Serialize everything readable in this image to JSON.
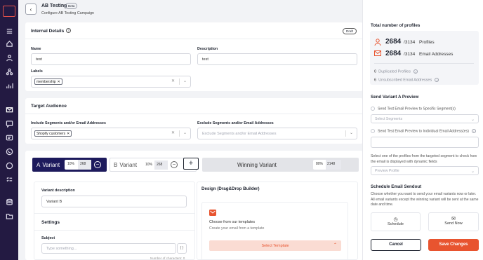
{
  "header": {
    "title": "AB Testing",
    "badge": "Beta",
    "subtitle": "Configure AB Testing Campaign",
    "back_icon": "arrow-left-icon"
  },
  "internal": {
    "title": "Internal Details",
    "status": "Draft",
    "name_label": "Name",
    "name_value": "test",
    "desc_label": "Description",
    "desc_value": "test",
    "labels_label": "Labels",
    "label_chip": "membership"
  },
  "audience": {
    "title": "Target Audience",
    "include_label": "Include Segments and/or Email Addresses",
    "include_chip": "Shopify customers",
    "exclude_label": "Exclude Segments and/or Email Addresses",
    "exclude_placeholder": "Exclude Segments and/or Email Addresses"
  },
  "variants": {
    "a_label": "A",
    "a_text": "Variant",
    "a_pct": "10%",
    "a_count": "268",
    "b_label": "B",
    "b_text": "Variant",
    "b_pct": "10%",
    "b_count": "268",
    "add": "+",
    "winning": "Winning Variant",
    "w_pct": "80%",
    "w_count": "2148"
  },
  "variant_form": {
    "desc_label": "Variant description",
    "desc_value": "Variant B",
    "settings_title": "Settings",
    "subject_label": "Subject",
    "subject_placeholder": "Type something...",
    "braces": "{ }",
    "char_count": "Number of characters: 0"
  },
  "design": {
    "title": "Design (Drag&Drop Builder)",
    "choose_title": "Choose from our templates",
    "choose_sub": "Create your email from a template",
    "select_btn": "Select Template"
  },
  "right": {
    "profiles_title": "Total number of profiles",
    "profiles_count": "2684",
    "profiles_total": "/3134",
    "profiles_unit": "Profiles",
    "emails_count": "2684",
    "emails_total": "/3134",
    "emails_unit": "Email Addresses",
    "dup_count": "0",
    "dup_label": "Duplicated Profiles",
    "unsub_count": "6",
    "unsub_label": "Unsubscribed Email Addresses",
    "send_title": "Send Variant A Preview",
    "seg_option": "Send Test Email Preview to Specific Segment(s)",
    "seg_placeholder": "Select Segments",
    "ind_option": "Send Test Email Preview to Individual Email Address(es)",
    "preview_help": "Select one of the profiles from the targeted segment to check how the email is displayed with dynamic fields",
    "preview_placeholder": "Preview Profile",
    "schedule_title": "Schedule Email Sendout",
    "schedule_help": "Choose whether you want to send your email variants now or later. All email variants except the winning variant will be sent at the same date and time.",
    "schedule_label": "Schedule",
    "send_now_label": "Send Now",
    "cancel": "Cancel",
    "save": "Save Changes"
  },
  "colors": {
    "brand": "#231a42",
    "accent": "#e8542f",
    "navy": "#1d1a5c"
  }
}
